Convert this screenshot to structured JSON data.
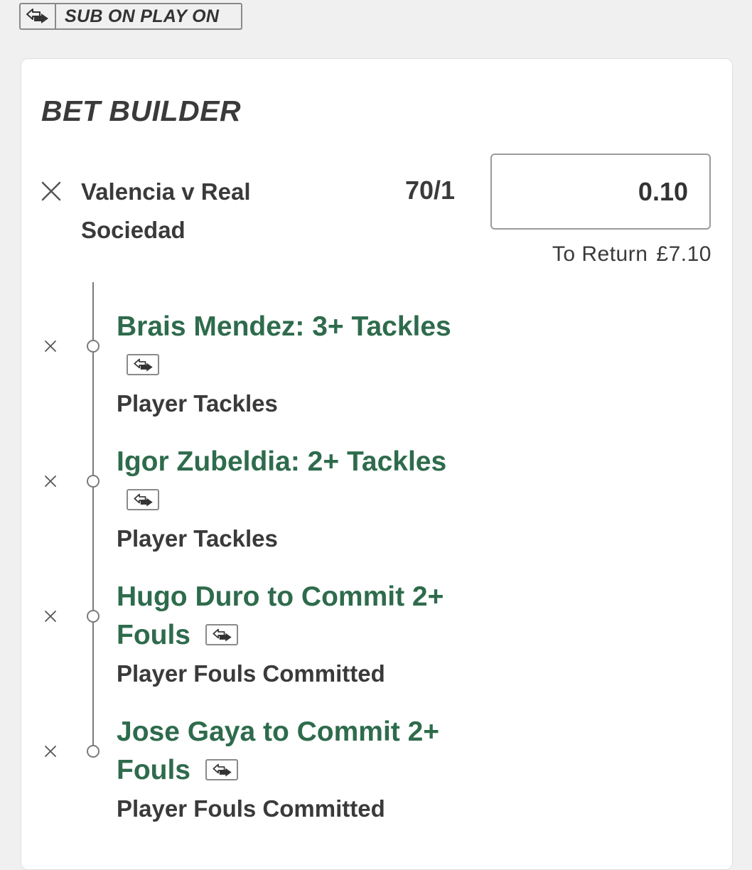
{
  "badge": {
    "icon": "sub-on-play-on-icon",
    "label": "SUB ON PLAY ON"
  },
  "bet_builder": {
    "title": "BET BUILDER",
    "match": "Valencia v Real Sociedad",
    "odds": "70/1",
    "stake": "0.10",
    "to_return_label": "To Return",
    "to_return_value": "£7.10",
    "legs": [
      {
        "selection": "Brais Mendez: 3+ Tackles",
        "market": "Player Tackles"
      },
      {
        "selection": "Igor Zubeldia: 2+ Tackles",
        "market": "Player Tackles"
      },
      {
        "selection": "Hugo Duro to Commit 2+ Fouls",
        "market": "Player Fouls Committed"
      },
      {
        "selection": "Jose Gaya to Commit 2+ Fouls",
        "market": "Player Fouls Committed"
      }
    ]
  },
  "colors": {
    "selection_green": "#2e6b4c",
    "text_dark": "#3a3a3a",
    "background": "#f0f0f0"
  }
}
